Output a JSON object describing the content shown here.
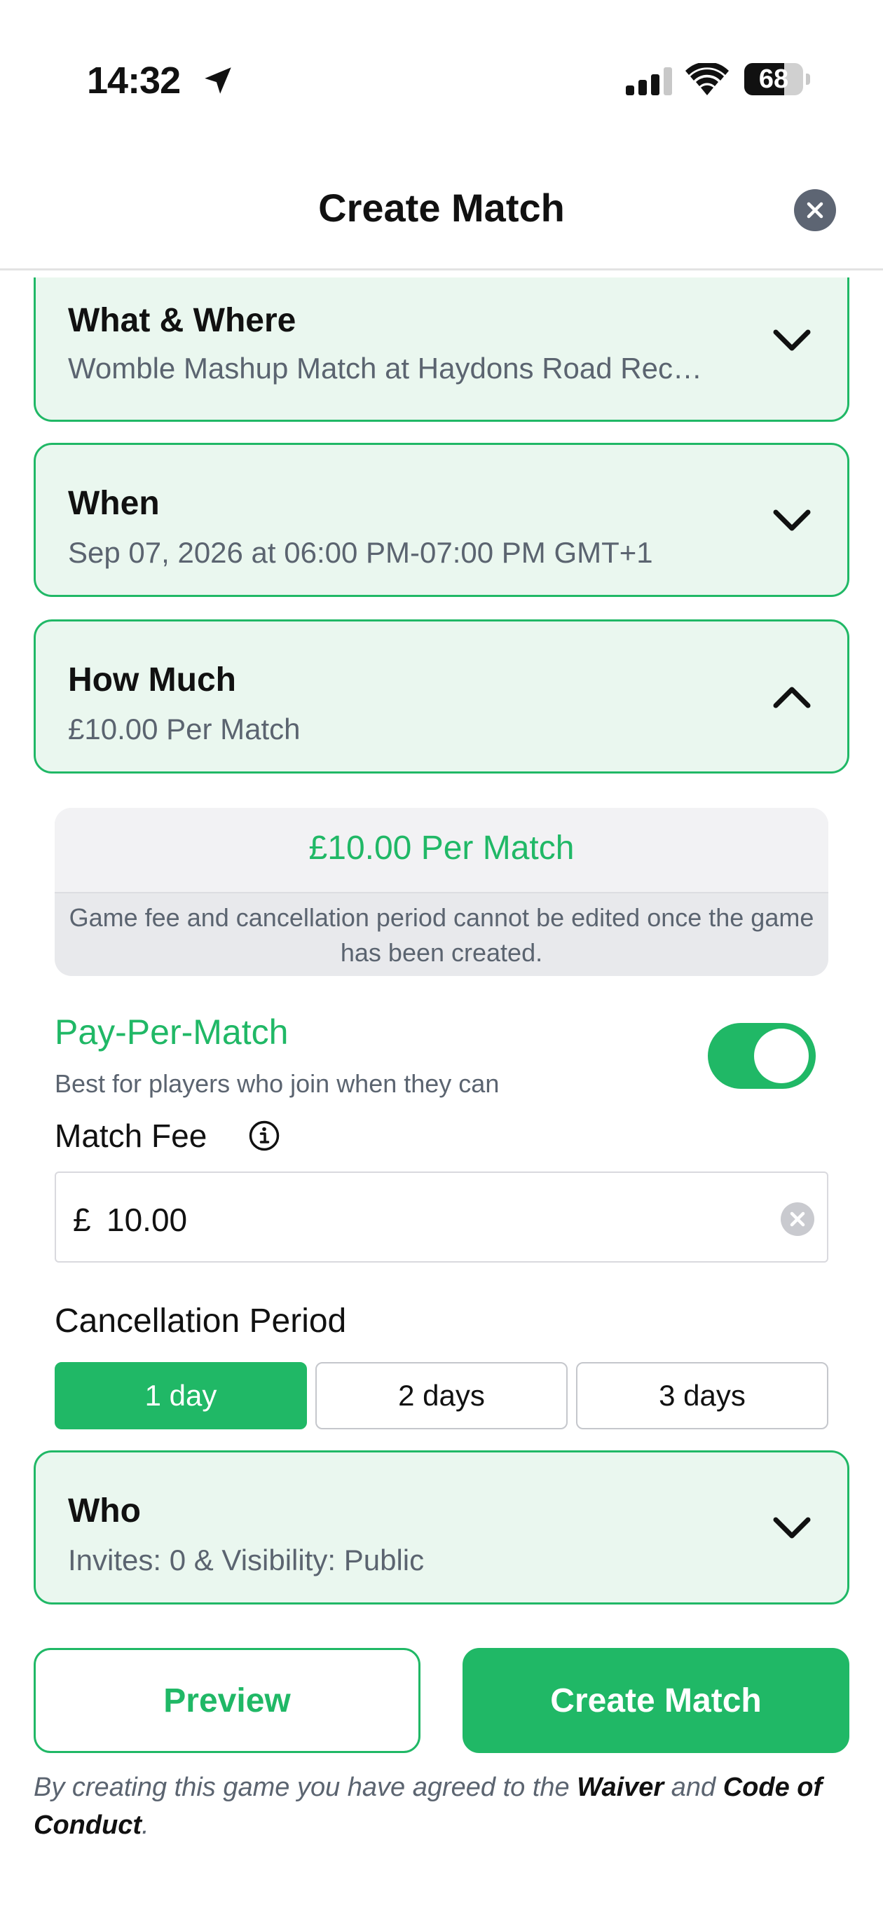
{
  "status_bar": {
    "time": "14:32",
    "battery": "68",
    "battery_level": 0.68
  },
  "header": {
    "title": "Create Match"
  },
  "sections": {
    "what_where": {
      "title": "What & Where",
      "subtitle": "Womble Mashup Match at Haydons Road Rec…"
    },
    "when": {
      "title": "When",
      "subtitle": "Sep 07, 2026 at 06:00 PM-07:00 PM GMT+1"
    },
    "how_much": {
      "title": "How Much",
      "subtitle": "£10.00 Per Match"
    },
    "who": {
      "title": "Who",
      "subtitle": "Invites: 0 & Visibility: Public"
    }
  },
  "pricing": {
    "summary": "£10.00 Per Match",
    "note": "Game fee and cancellation period cannot be edited once the game has been created.",
    "pay_per_match_label": "Pay-Per-Match",
    "pay_per_match_desc": "Best for players who join when they can",
    "pay_per_match_on": true,
    "fee_label": "Match Fee",
    "currency": "£",
    "fee_value": "10.00",
    "cancellation_label": "Cancellation Period",
    "cancellation_options": [
      "1 day",
      "2 days",
      "3 days"
    ],
    "cancellation_selected": "1 day"
  },
  "actions": {
    "preview_label": "Preview",
    "create_label": "Create Match"
  },
  "legal": {
    "prefix": "By creating this game you have agreed to the ",
    "waiver": "Waiver",
    "and": " and ",
    "code": "Code of Conduct",
    "suffix": "."
  },
  "colors": {
    "accent": "#20b866",
    "section_bg": "#eaf7ef",
    "muted_text": "#5b6470"
  },
  "icons": {
    "location": "location-arrow-icon",
    "signal": "cellular-signal-icon",
    "wifi": "wifi-icon",
    "close": "close-icon",
    "chevron_down": "chevron-down-icon",
    "chevron_up": "chevron-up-icon",
    "info": "info-icon",
    "clear": "clear-icon"
  }
}
